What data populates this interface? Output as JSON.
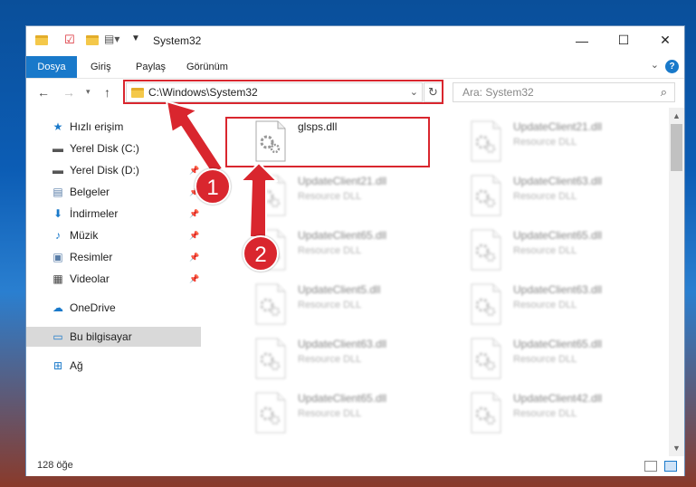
{
  "window": {
    "title": "System32",
    "controls": {
      "minimize": "—",
      "maximize": "☐",
      "close": "✕"
    }
  },
  "ribbon": {
    "tabs": [
      {
        "label": "Dosya"
      },
      {
        "label": "Giriş"
      },
      {
        "label": "Paylaş"
      },
      {
        "label": "Görünüm"
      }
    ],
    "help": "?"
  },
  "nav": {
    "address": "C:\\Windows\\System32",
    "search_placeholder": "Ara: System32"
  },
  "sidebar": {
    "items": [
      {
        "label": "Hızlı erişim",
        "icon": "star-icon",
        "glyph": "★",
        "color": "#1979ca",
        "pinned": false
      },
      {
        "label": "Yerel Disk (C:)",
        "icon": "drive-icon",
        "glyph": "▬",
        "color": "#555555",
        "pinned": false
      },
      {
        "label": "Yerel Disk (D:)",
        "icon": "drive-icon",
        "glyph": "▬",
        "color": "#555555",
        "pinned": true
      },
      {
        "label": "Belgeler",
        "icon": "documents-icon",
        "glyph": "▤",
        "color": "#5a7ea8",
        "pinned": true
      },
      {
        "label": "İndirmeler",
        "icon": "download-icon",
        "glyph": "⬇",
        "color": "#1979ca",
        "pinned": true
      },
      {
        "label": "Müzik",
        "icon": "music-icon",
        "glyph": "♪",
        "color": "#1979ca",
        "pinned": true
      },
      {
        "label": "Resimler",
        "icon": "pictures-icon",
        "glyph": "▣",
        "color": "#5a7ea8",
        "pinned": true
      },
      {
        "label": "Videolar",
        "icon": "video-icon",
        "glyph": "▦",
        "color": "#444444",
        "pinned": true
      },
      {
        "label": "OneDrive",
        "icon": "cloud-icon",
        "glyph": "☁",
        "color": "#1979ca",
        "pinned": false
      },
      {
        "label": "Bu bilgisayar",
        "icon": "computer-icon",
        "glyph": "▭",
        "color": "#1979ca",
        "pinned": false,
        "selected": true
      },
      {
        "label": "Ağ",
        "icon": "network-icon",
        "glyph": "⊞",
        "color": "#1979ca",
        "pinned": false
      }
    ]
  },
  "files": [
    {
      "name": "glsps.dll",
      "type": "",
      "blurred": false
    },
    {
      "name": "UpdateClient21.dll",
      "type": "Resource DLL",
      "blurred": true
    },
    {
      "name": "UpdateClient21.dll",
      "type": "Resource DLL",
      "blurred": true
    },
    {
      "name": "UpdateClient63.dll",
      "type": "Resource DLL",
      "blurred": true
    },
    {
      "name": "UpdateClient65.dll",
      "type": "Resource DLL",
      "blurred": true
    },
    {
      "name": "UpdateClient65.dll",
      "type": "Resource DLL",
      "blurred": true
    },
    {
      "name": "UpdateClient5.dll",
      "type": "Resource DLL",
      "blurred": true
    },
    {
      "name": "UpdateClient63.dll",
      "type": "Resource DLL",
      "blurred": true
    },
    {
      "name": "UpdateClient63.dll",
      "type": "Resource DLL",
      "blurred": true
    },
    {
      "name": "UpdateClient65.dll",
      "type": "Resource DLL",
      "blurred": true
    },
    {
      "name": "UpdateClient65.dll",
      "type": "Resource DLL",
      "blurred": true
    },
    {
      "name": "UpdateClient42.dll",
      "type": "Resource DLL",
      "blurred": true
    }
  ],
  "status": {
    "count": "128 öğe"
  },
  "annotations": {
    "badge1": "1",
    "badge2": "2",
    "color": "#d9262e"
  }
}
